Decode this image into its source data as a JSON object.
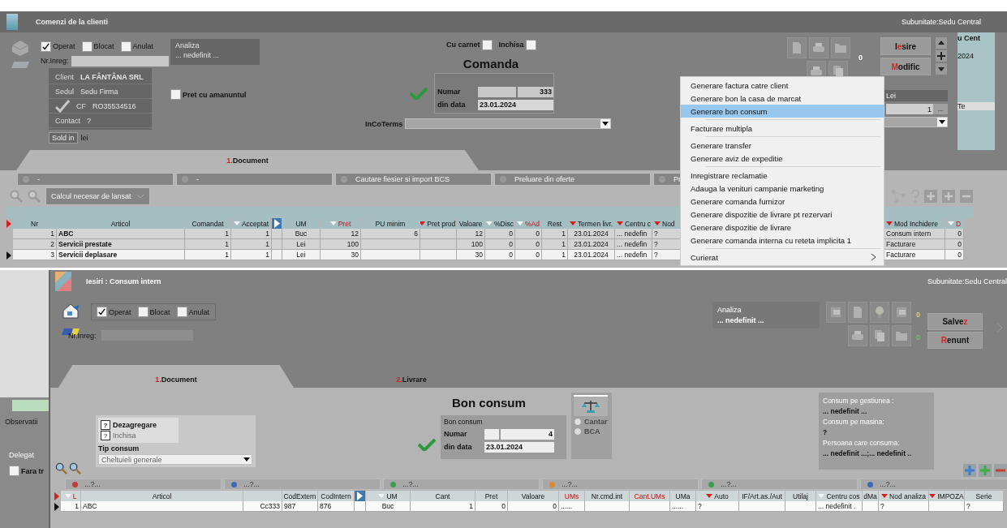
{
  "order_window": {
    "title": "Comenzi de la clienti",
    "subunit": "Subunitate:Sedu Central",
    "status_checks": [
      {
        "label": "Operat",
        "checked": true
      },
      {
        "label": "Blocat",
        "checked": false
      },
      {
        "label": "Anulat",
        "checked": false
      }
    ],
    "nr_inreg_label": "Nr.Inreg:",
    "analiza": {
      "label": "Analiza",
      "value": "... nedefinit ..."
    },
    "client_rows": [
      {
        "label": "Client",
        "value": "LA FÂNTÂNA SRL"
      },
      {
        "label": "Sedul",
        "value": "Sedu Firma"
      },
      {
        "label": "CF",
        "value": "RO35534516"
      },
      {
        "label": "Contact",
        "value": "?"
      }
    ],
    "sold_label": "Sold in",
    "sold_unit": "lei",
    "retail_check": {
      "label": "Pret cu amanuntul",
      "checked": false
    },
    "flags": [
      {
        "label": "Cu carnet",
        "checked": false
      },
      {
        "label": "Inchisa",
        "checked": false
      }
    ],
    "doc_title": "Comanda",
    "number_label": "Numar",
    "number": "333",
    "date_label": "din data",
    "date": "23.01.2024",
    "incoterms_label": "InCoTerms",
    "counter": "0",
    "buttons": [
      {
        "before": "I",
        "key": "e",
        "after": "sire"
      },
      {
        "key": "M",
        "after": "odific"
      }
    ],
    "currency": "Lei",
    "rate": "1",
    "rate_button": "...",
    "tabs": [
      {
        "number": "1.",
        "label": " Document",
        "selected": true
      }
    ],
    "toolbar": [
      "-",
      "-",
      "Cautare fiesier si import BCS",
      "Preluare din oferte",
      "Pr"
    ],
    "calc_dropdown": "Calcul necesar de lansat",
    "table": {
      "columns": [
        {
          "label": "Nr",
          "red": false
        },
        {
          "label": "Articol",
          "red": false
        },
        {
          "label": "Comandat",
          "red": false
        },
        {
          "label": "Acceptat",
          "color": "#f4f4f4",
          "red": false
        },
        {
          "kind": "arrow"
        },
        {
          "label": "UM",
          "red": false
        },
        {
          "label": "Pret",
          "color": "#f4f4f4",
          "red": true
        },
        {
          "label": "PU minim",
          "red": false
        },
        {
          "label": "Pret prod.",
          "color": "#d02020",
          "red": false
        },
        {
          "label": "Valoare",
          "red": false
        },
        {
          "label": "%Disc",
          "color": "#f4f4f4",
          "red": false
        },
        {
          "label": "%Ad",
          "color": "#f4f4f4",
          "red": true
        },
        {
          "label": "Rest",
          "red": false
        },
        {
          "label": "Termen livr.",
          "color": "#d02020",
          "red": false
        },
        {
          "label": "Centru c",
          "color": "#d02020",
          "red": false
        },
        {
          "label": "Nod",
          "color": "#d02020",
          "red": false
        },
        {
          "label": "Mod Inchidere",
          "color": "#d02020",
          "red": false
        },
        {
          "label": "D",
          "color": "#f4f4f4",
          "red": true
        }
      ],
      "rows": [
        {
          "current": false,
          "cells": [
            "1",
            "ABC",
            "1",
            "1",
            null,
            "Buc",
            "12",
            "6",
            null,
            "12",
            "0",
            "0",
            "1",
            "23.01.2024",
            "... nedefin",
            "?",
            "Consum intern",
            "0"
          ]
        },
        {
          "current": false,
          "cells": [
            "2",
            "Servicii prestate",
            "1",
            "1",
            null,
            "Lei",
            "100",
            null,
            null,
            "100",
            "0",
            "0",
            "1",
            "23.01.2024",
            "... nedefin",
            "?",
            "Facturare",
            "0"
          ]
        },
        {
          "current": true,
          "cells": [
            "3",
            "Servicii deplasare",
            "1",
            "1",
            null,
            "Lei",
            "30",
            null,
            null,
            "30",
            "0",
            "0",
            "1",
            "23.01.2024",
            "... nedefin",
            "?",
            "Facturare",
            "0"
          ]
        }
      ]
    }
  },
  "context_menu": {
    "groups": [
      [
        {
          "label": "Generare factura catre client",
          "selected": false,
          "kind": "action"
        },
        {
          "label": "Generare bon la casa de marcat",
          "selected": false,
          "kind": "action"
        },
        {
          "label": "Generare bon consum",
          "selected": true,
          "kind": "action"
        }
      ],
      [
        {
          "label": "Facturare multipla",
          "selected": false,
          "kind": "action"
        }
      ],
      [
        {
          "label": "Generare transfer",
          "selected": false,
          "kind": "action"
        },
        {
          "label": "Generare aviz de expeditie",
          "selected": false,
          "kind": "action"
        }
      ],
      [
        {
          "label": "Inregistrare reclamatie",
          "selected": false,
          "kind": "action"
        },
        {
          "label": "Adauga la venituri campanie marketing",
          "selected": false,
          "kind": "action"
        },
        {
          "label": "Generare comanda furnizor",
          "selected": false,
          "kind": "action"
        },
        {
          "label": "Generare dispozitie de livrare pt rezervari",
          "selected": false,
          "kind": "action"
        },
        {
          "label": "Generare dispozitie de livrare",
          "selected": false,
          "kind": "action"
        },
        {
          "label": "Generare comanda interna cu reteta implicita 1",
          "selected": false,
          "kind": "action"
        }
      ],
      [
        {
          "label": "Curierat",
          "selected": false,
          "kind": "submenu"
        }
      ]
    ]
  },
  "other_window": {
    "title_fragment": "u Cent",
    "date_fragment": "2024",
    "column_fragment": "Te"
  },
  "underlying_form": {
    "observatii": "Observatii",
    "delegat": "Delegat",
    "fara": {
      "label": "Fara tr",
      "checked": false
    }
  },
  "consum_window": {
    "title": "Iesiri : Consum intern",
    "subunit": "Subunitate:Sedu Central",
    "status_checks": [
      {
        "label": "Operat",
        "checked": true
      },
      {
        "label": "Blocat",
        "checked": false
      },
      {
        "label": "Anulat",
        "checked": false
      }
    ],
    "nr_inreg_label": "Nr.Inreg:",
    "analiza": {
      "label": "Analiza",
      "value": "... nedefinit ..."
    },
    "counters": [
      {
        "value": "0",
        "color": "#e0c880"
      },
      {
        "value": "0",
        "color": "#6cc070"
      }
    ],
    "buttons": [
      {
        "before": "Salve",
        "key": "z"
      },
      {
        "key": "R",
        "after": "enunt"
      }
    ],
    "tabs": [
      {
        "number": "1.",
        "label": "Document",
        "selected": true
      },
      {
        "number": "2.",
        "label": "Livrare",
        "selected": false
      }
    ],
    "options": [
      {
        "mark": "?",
        "label": "Dezagregare",
        "disabled": false
      },
      {
        "mark": "?",
        "label": "Inchisa",
        "disabled": true
      }
    ],
    "tip_consum_label": "Tip consum",
    "tip_consum": "Cheltuieli generale",
    "doc_title": "Bon consum",
    "box_label": "Bon consum",
    "number_label": "Numar",
    "number": "4",
    "date_label": "din data",
    "date": "23.01.2024",
    "scale_options": [
      {
        "label": "Cantar",
        "selected": false,
        "disabled": true
      },
      {
        "label": "BCA",
        "selected": false,
        "disabled": true
      }
    ],
    "info": [
      {
        "label": "Consum pe gestiunea :",
        "value": "... nedefinit ..."
      },
      {
        "label": "Consum pe masina:",
        "value": "?"
      },
      {
        "label": "Persoana care consuma:",
        "value": "... nedefinit ...;... nedefinit .."
      }
    ],
    "toolbar": [
      {
        "label": "...?...",
        "color": "#c03a3a"
      },
      {
        "label": "...?...",
        "color": "#3a6ac0"
      },
      {
        "label": "...?...",
        "color": "#3aa050"
      },
      {
        "label": "...?...",
        "color": "#e08a30"
      },
      {
        "label": "...?...",
        "color": "#3aa050"
      },
      {
        "label": "...?...",
        "color": "#3a6ac0"
      }
    ],
    "table": {
      "columns": [
        {
          "label": "L",
          "color": "#f4f4f4",
          "red": true
        },
        {
          "label": "Articol",
          "red": false
        },
        {
          "kind": "blank"
        },
        {
          "label": "CodExtern",
          "red": false
        },
        {
          "label": "CodIntern",
          "red": false
        },
        {
          "kind": "arrow"
        },
        {
          "label": "UM",
          "color": "#f4f4f4",
          "red": false
        },
        {
          "label": "Cant",
          "red": false
        },
        {
          "label": "Pret",
          "red": false
        },
        {
          "label": "Valoare",
          "red": false
        },
        {
          "label": "UMs",
          "red": true
        },
        {
          "label": "Nr.cmd.int",
          "red": false
        },
        {
          "label": "Cant.UMs",
          "red": true
        },
        {
          "label": "UMa",
          "red": false
        },
        {
          "label": "Auto",
          "color": "#d02020",
          "red": false
        },
        {
          "label": "IF/Art.as./Aut",
          "red": false
        },
        {
          "label": "Utilaj",
          "red": false
        },
        {
          "label": "Centru cos",
          "color": "#f4f4f4",
          "red": false
        },
        {
          "label": "dMa",
          "red": false
        },
        {
          "label": "Nod analiza",
          "color": "#d02020",
          "red": false
        },
        {
          "label": "IMPOZA",
          "color": "#d02020",
          "red": false
        },
        {
          "label": "Serie",
          "red": false
        }
      ],
      "rows": [
        {
          "current": true,
          "cells": [
            "1",
            "ABC",
            "Cc333",
            "987",
            "876",
            null,
            "Buc",
            "1",
            "0",
            "0",
            "......",
            null,
            null,
            "......",
            "?",
            null,
            null,
            "... nedefinit .",
            null,
            "?",
            null,
            "?"
          ]
        }
      ]
    }
  }
}
